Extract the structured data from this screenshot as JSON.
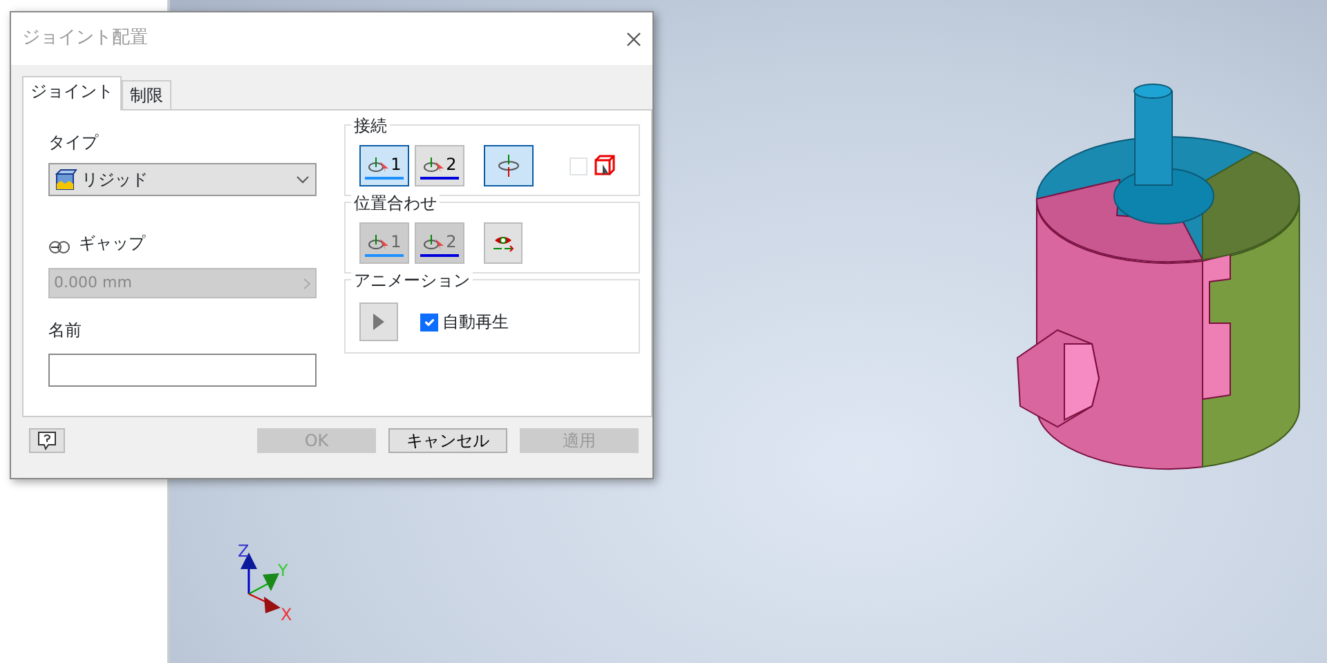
{
  "dialog": {
    "title": "ジョイント配置",
    "tabs": [
      {
        "label": "ジョイント",
        "selected": true
      },
      {
        "label": "制限",
        "selected": false
      }
    ],
    "type": {
      "label": "タイプ",
      "value": "リジッド"
    },
    "gap": {
      "label": "ギャップ",
      "value": "0.000 mm",
      "disabled": true
    },
    "name": {
      "label": "名前"
    },
    "connection": {
      "legend": "接続",
      "buttons": [
        {
          "label": "1",
          "selected": true
        },
        {
          "label": "2",
          "selected": false
        }
      ],
      "flip": {
        "selected": true
      },
      "checkbox": {
        "checked": false
      }
    },
    "alignment": {
      "legend": "位置合わせ",
      "buttons": [
        {
          "label": "1",
          "disabled": true
        },
        {
          "label": "2",
          "disabled": true
        }
      ]
    },
    "animation": {
      "legend": "アニメーション",
      "autoplay": {
        "label": "自動再生",
        "checked": true
      }
    },
    "footer_buttons": [
      {
        "label": "OK",
        "disabled": true
      },
      {
        "label": "キャンセル",
        "disabled": false
      },
      {
        "label": "適用",
        "disabled": true
      }
    ]
  },
  "triad": {
    "axes": [
      "Z",
      "Y",
      "X"
    ]
  }
}
